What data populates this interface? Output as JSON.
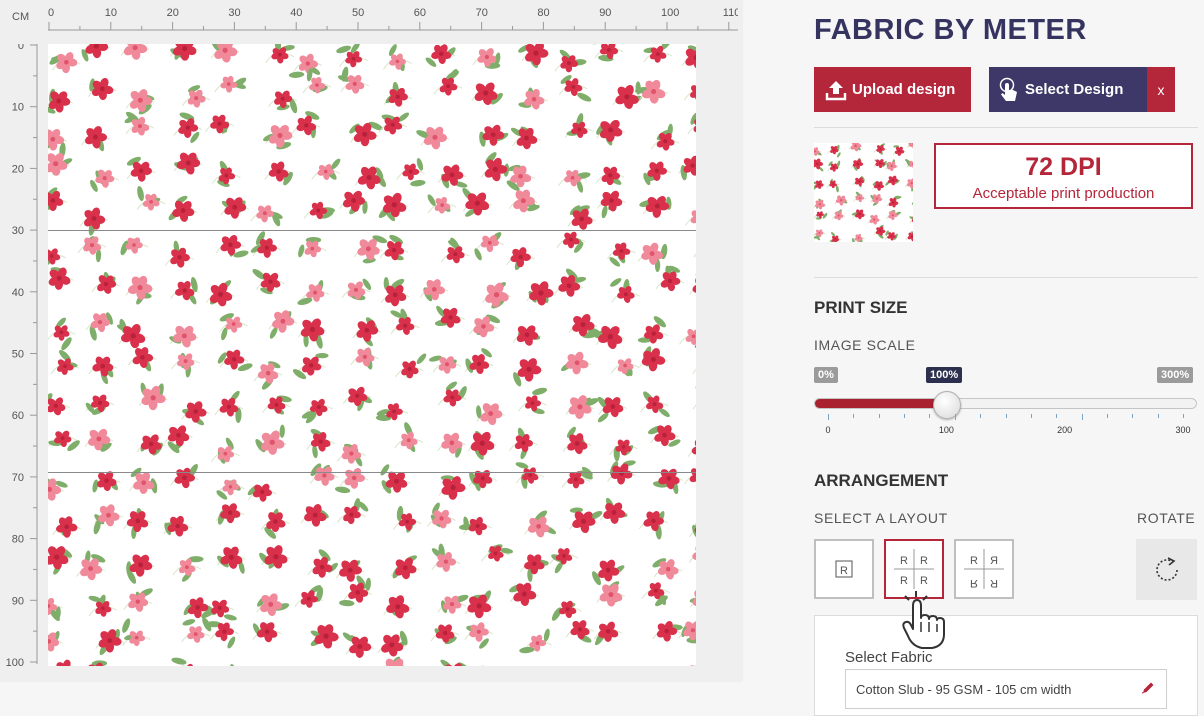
{
  "ruler": {
    "unit": "CM",
    "h_labels": [
      "0",
      "10",
      "20",
      "30",
      "40",
      "50",
      "60",
      "70",
      "80",
      "90",
      "100",
      "110"
    ],
    "v_labels": [
      "0",
      "10",
      "20",
      "30",
      "40",
      "50",
      "60",
      "70",
      "80",
      "90",
      "100"
    ]
  },
  "canvas": {
    "pattern_icon": "floral-pattern",
    "colors": {
      "petal_dark": "#d9304b",
      "petal_light": "#f08a9a",
      "leaf": "#7fae6a",
      "stem": "#d9e6c9"
    }
  },
  "panel": {
    "title": "FABRIC BY METER",
    "upload_label": "Upload design",
    "select_label": "Select Design",
    "clear_label": "x",
    "dpi_value": "72 DPI",
    "dpi_text": "Acceptable print production",
    "print_size_heading": "PRINT SIZE",
    "image_scale_label": "IMAGE SCALE",
    "scale_min_badge": "0%",
    "scale_current_badge": "100%",
    "scale_max_badge": "300%",
    "scale_tick_labels": [
      "0",
      "100",
      "200",
      "300"
    ],
    "scale": {
      "min": 0,
      "max": 300,
      "value": 100
    },
    "arrangement_heading": "ARRANGEMENT",
    "select_layout_label": "SELECT A LAYOUT",
    "rotate_label": "ROTATE",
    "layouts": [
      {
        "name": "single",
        "letter": "R"
      },
      {
        "name": "repeat",
        "letter": "R",
        "selected": true
      },
      {
        "name": "mirror",
        "letter": "R"
      }
    ],
    "select_fabric_label": "Select Fabric",
    "fabric_value": "Cotton Slub - 95 GSM - 105 cm width"
  },
  "colors": {
    "accent_red": "#b4263a",
    "navy": "#35335f",
    "button_navy": "#3e3869"
  }
}
